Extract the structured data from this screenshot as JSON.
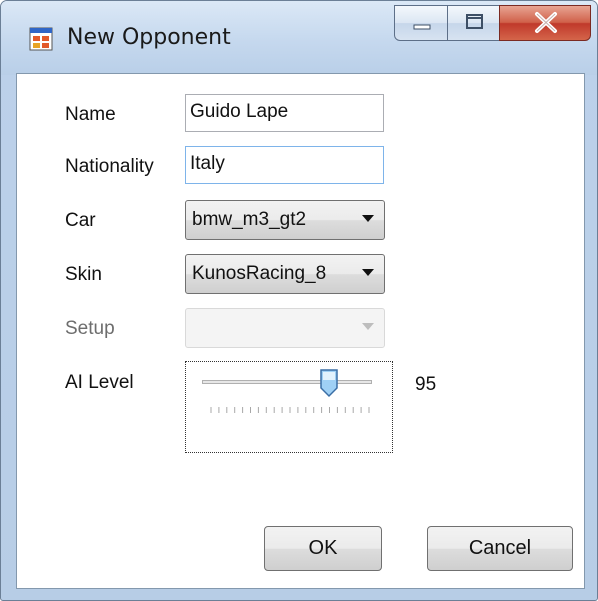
{
  "window": {
    "title": "New Opponent"
  },
  "form": {
    "name_label": "Name",
    "name_value": "Guido Lape",
    "nationality_label": "Nationality",
    "nationality_value": "Italy",
    "car_label": "Car",
    "car_value": "bmw_m3_gt2",
    "skin_label": "Skin",
    "skin_value": "KunosRacing_8",
    "setup_label": "Setup",
    "setup_value": "",
    "ai_level_label": "AI Level",
    "ai_level_value": "95",
    "ai_level_fraction": 0.95
  },
  "buttons": {
    "ok": "OK",
    "cancel": "Cancel"
  },
  "icons": {
    "title": "form-window-icon",
    "minimize": "minimize-icon",
    "maximize": "maximize-icon",
    "close": "close-icon",
    "dropdown": "chevron-down-icon"
  },
  "colors": {
    "close_button": "#c0392b",
    "focus_border": "#7eb4ea",
    "slider_thumb": "#5b9bd5"
  }
}
